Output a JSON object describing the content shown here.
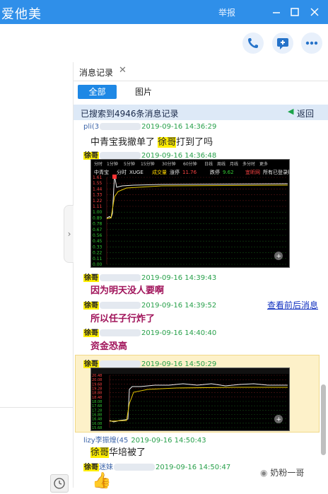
{
  "window": {
    "title": "爱他美",
    "report_label": "举报",
    "minimize_icon": "minimize-icon",
    "maximize_icon": "maximize-icon",
    "close_icon": "close-icon"
  },
  "toolbar": {
    "buttons": [
      "phone-icon",
      "message-add-icon",
      "more-icon"
    ]
  },
  "tab": {
    "label": "消息记录",
    "close": "✕"
  },
  "filter": {
    "all_label": "全部",
    "image_label": "图片"
  },
  "banner": {
    "text": "已搜索到4946条消息记录",
    "back_label": "返回"
  },
  "messages": [
    {
      "sender": "pli(3",
      "time": "2019-09-16 14:36:29",
      "text_a": "中青宝我撤单了",
      "text_b": "徐哥",
      "text_c": "打到了吗"
    },
    {
      "sender": "徐哥",
      "time": "2019-09-16 14:36:48"
    },
    {
      "sender": "徐哥",
      "time": "2019-09-16 14:39:43",
      "text": "因为明天没人要啊"
    },
    {
      "sender": "徐哥",
      "time": "2019-09-16 14:39:52",
      "text": "所以任子行炸了"
    },
    {
      "sender": "徐哥",
      "time": "2019-09-16 14:40:40",
      "text": "资金恐高"
    },
    {
      "sender": "徐哥",
      "time": "2019-09-16 14:50:29"
    },
    {
      "sender": "lizy李振煌(45",
      "time": "2019-09-16 14:50:43",
      "text_a": "徐哥",
      "text_b": "华培被了"
    },
    {
      "sender": "徐哥",
      "sender_suffix": "迷妹",
      "time": "2019-09-16 14:50:47"
    }
  ],
  "view_context_label": "查看前后消息",
  "chart1": {
    "toolbar_labels": [
      "分时",
      "1分钟",
      "5分钟",
      "15分钟",
      "30分钟",
      "60分钟",
      "日线",
      "周线",
      "月线",
      "多分时",
      "更多"
    ],
    "stock_name": "中青宝",
    "header_labels": [
      "分时",
      "XUGE",
      "成交量",
      "涨停",
      "11.76",
      "跌停",
      "9.62",
      "宜昕网",
      "所有已登录账户"
    ],
    "y_labels": [
      "1.61",
      "1.55",
      "1.44",
      "1.33",
      "1.22",
      "1.11",
      "1.00",
      "0.89",
      "0.78",
      "0.67",
      "0.56",
      "0.45",
      "0.33",
      "0.22",
      "0.11",
      "0.00"
    ]
  },
  "chart2": {
    "y_labels": [
      "20.48",
      "20.08",
      "19.68",
      "19.28",
      "18.88",
      "18.48",
      "18.08",
      "17.68",
      "17.28",
      "16.88",
      "16.48",
      "16.08",
      "15.68"
    ]
  },
  "watermark": "奶粉一哥",
  "emoji": "👍"
}
